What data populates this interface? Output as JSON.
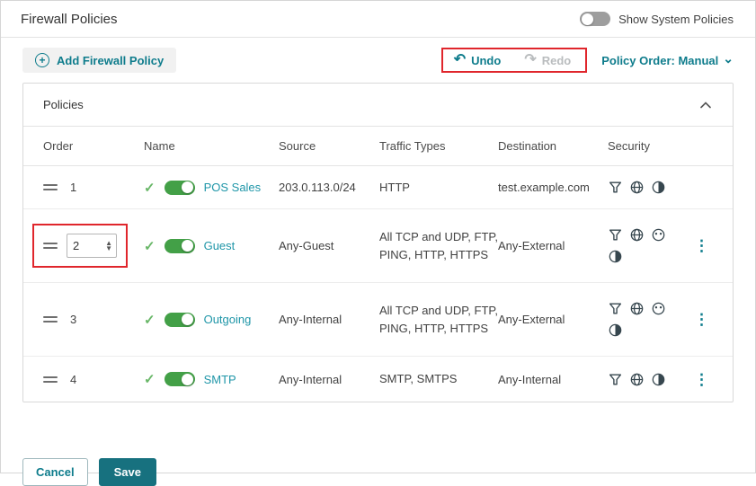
{
  "colors": {
    "accent": "#0e7c8c",
    "toggle_green": "#43a047",
    "highlight_red": "#e0262c"
  },
  "header": {
    "title": "Firewall Policies",
    "show_system_label": "Show System Policies",
    "show_system_toggle_state": "off"
  },
  "toolbar": {
    "add_label": "Add Firewall Policy",
    "undo_label": "Undo",
    "redo_label": "Redo",
    "policy_order_label": "Policy Order: Manual"
  },
  "icons": {
    "plus": "+",
    "undo": "↶",
    "redo": "↷",
    "chevron_down": "⌄",
    "check": "✓",
    "kebab": "⋮"
  },
  "panel": {
    "title": "Policies"
  },
  "table": {
    "columns": [
      "Order",
      "Name",
      "Source",
      "Traffic Types",
      "Destination",
      "Security"
    ],
    "order_input_value": "2",
    "rows": [
      {
        "order": "1",
        "enabled": true,
        "name": "POS Sales",
        "source": "203.0.113.0/24",
        "traffic": "HTTP",
        "destination": "test.example.com",
        "security": [
          "filter",
          "globe",
          "proxy"
        ],
        "menu": false
      },
      {
        "order": "2",
        "enabled": true,
        "name": "Guest",
        "source": "Any-Guest",
        "traffic": "All TCP and UDP, FTP, PING, HTTP, HTTPS",
        "destination": "Any-External",
        "security": [
          "filter",
          "globe",
          "app-control",
          "proxy"
        ],
        "menu": true
      },
      {
        "order": "3",
        "enabled": true,
        "name": "Outgoing",
        "source": "Any-Internal",
        "traffic": "All TCP and UDP, FTP, PING, HTTP, HTTPS",
        "destination": "Any-External",
        "security": [
          "filter",
          "globe",
          "app-control",
          "proxy"
        ],
        "menu": true
      },
      {
        "order": "4",
        "enabled": true,
        "name": "SMTP",
        "source": "Any-Internal",
        "traffic": "SMTP, SMTPS",
        "destination": "Any-Internal",
        "security": [
          "filter",
          "globe",
          "proxy"
        ],
        "menu": true
      }
    ]
  },
  "footer": {
    "cancel_label": "Cancel",
    "save_label": "Save"
  }
}
